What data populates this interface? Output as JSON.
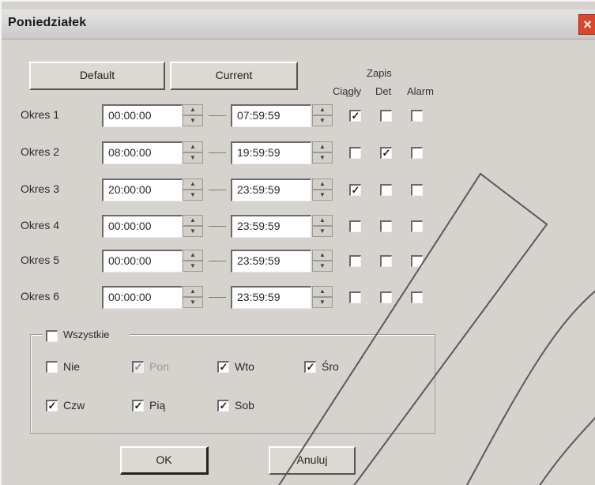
{
  "window": {
    "title": "Poniedziałek",
    "close_glyph": "×"
  },
  "buttons": {
    "default": "Default",
    "current": "Current",
    "ok": "OK",
    "cancel": "Anuluj"
  },
  "header": {
    "group_title": "Zapis",
    "continuous": "Ciągły",
    "detection": "Det",
    "alarm": "Alarm"
  },
  "spinner": {
    "up": "▲",
    "down": "▼"
  },
  "periods": [
    {
      "label": "Okres 1",
      "start": "00:00:00",
      "end": "07:59:59",
      "continuous": true,
      "detection": false,
      "alarm": false
    },
    {
      "label": "Okres 2",
      "start": "08:00:00",
      "end": "19:59:59",
      "continuous": false,
      "detection": true,
      "alarm": false
    },
    {
      "label": "Okres 3",
      "start": "20:00:00",
      "end": "23:59:59",
      "continuous": true,
      "detection": false,
      "alarm": false
    },
    {
      "label": "Okres 4",
      "start": "00:00:00",
      "end": "23:59:59",
      "continuous": false,
      "detection": false,
      "alarm": false
    },
    {
      "label": "Okres 5",
      "start": "00:00:00",
      "end": "23:59:59",
      "continuous": false,
      "detection": false,
      "alarm": false
    },
    {
      "label": "Okres 6",
      "start": "00:00:00",
      "end": "23:59:59",
      "continuous": false,
      "detection": false,
      "alarm": false
    }
  ],
  "copy_to": {
    "all_label": "Wszystkie",
    "all_checked": false,
    "days": [
      {
        "label": "Nie",
        "checked": false,
        "disabled": false
      },
      {
        "label": "Pon",
        "checked": true,
        "disabled": true
      },
      {
        "label": "Wto",
        "checked": true,
        "disabled": false
      },
      {
        "label": "Śro",
        "checked": true,
        "disabled": false
      },
      {
        "label": "Czw",
        "checked": true,
        "disabled": false
      },
      {
        "label": "Pią",
        "checked": true,
        "disabled": false
      },
      {
        "label": "Sob",
        "checked": true,
        "disabled": false
      }
    ]
  },
  "check_glyph": "✓"
}
